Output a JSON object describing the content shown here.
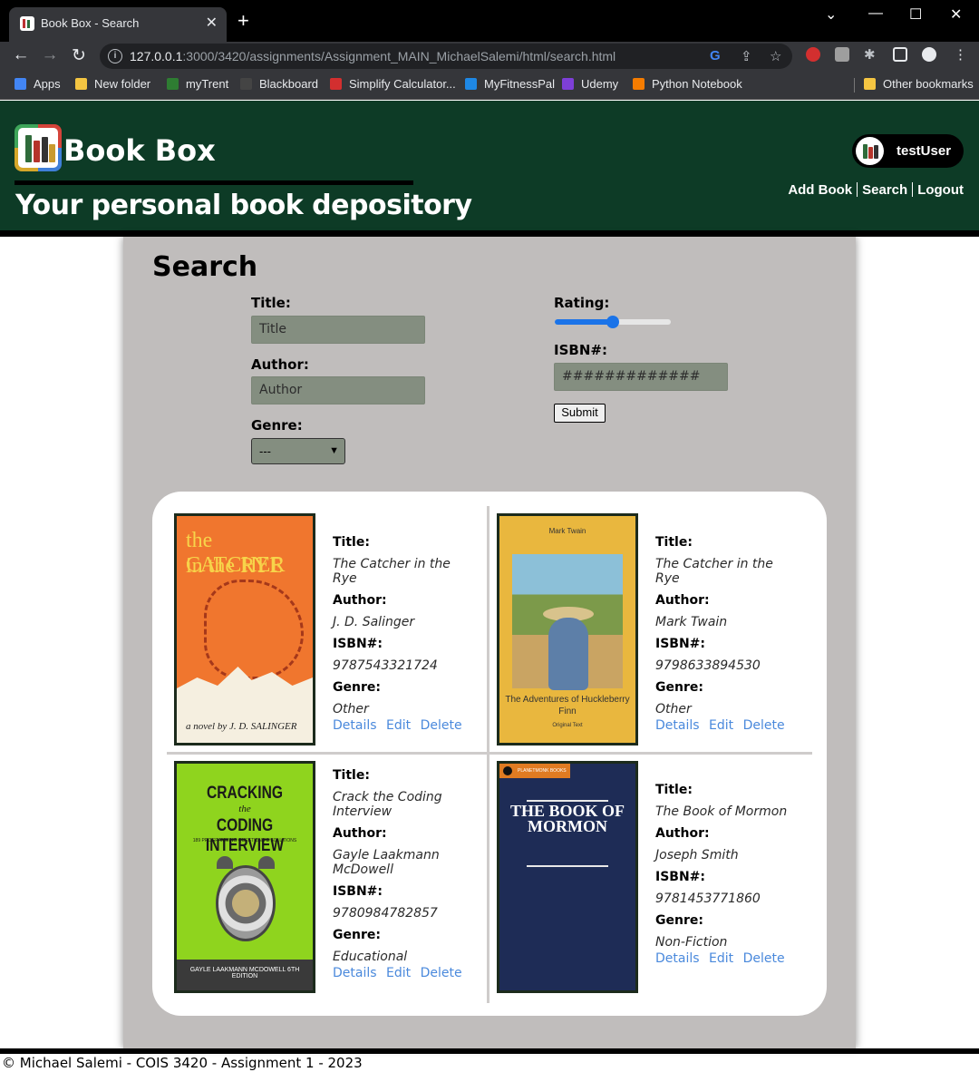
{
  "browser": {
    "tab_title": "Book Box - Search",
    "url_host": "127.0.0.1",
    "url_rest": ":3000/3420/assignments/Assignment_MAIN_MichaelSalemi/html/search.html",
    "bookmarks": [
      {
        "label": "Apps",
        "color": "#4285f4"
      },
      {
        "label": "New folder",
        "color": "#f4c542"
      },
      {
        "label": "myTrent",
        "color": "#2e7d32"
      },
      {
        "label": "Blackboard",
        "color": "#444444"
      },
      {
        "label": "Simplify Calculator...",
        "color": "#d32f2f"
      },
      {
        "label": "MyFitnessPal",
        "color": "#1e88e5"
      },
      {
        "label": "Udemy",
        "color": "#7e3fd8"
      },
      {
        "label": "Python Notebook",
        "color": "#f57c00"
      }
    ],
    "other_bookmarks": "Other bookmarks"
  },
  "site": {
    "title": "Book Box",
    "tagline": "Your personal book depository",
    "username": "testUser",
    "nav": [
      "Add Book",
      "Search",
      "Logout"
    ]
  },
  "search": {
    "heading": "Search",
    "title_label": "Title:",
    "title_placeholder": "Title",
    "author_label": "Author:",
    "author_placeholder": "Author",
    "genre_label": "Genre:",
    "genre_selected": "---",
    "rating_label": "Rating:",
    "rating_fraction": 0.5,
    "isbn_label": "ISBN#:",
    "isbn_placeholder": "#############",
    "submit_label": "Submit"
  },
  "labels": {
    "title": "Title:",
    "author": "Author:",
    "isbn": "ISBN#:",
    "genre": "Genre:",
    "details": "Details",
    "edit": "Edit",
    "delete": "Delete"
  },
  "books": [
    {
      "title": "The Catcher in the Rye",
      "author": "J. D. Salinger",
      "isbn": "9787543321724",
      "genre": "Other",
      "cover_title_1": "the CATCHER",
      "cover_title_2": "in the RYE",
      "cover_byline": "a novel by  J. D. SALINGER"
    },
    {
      "title": "The Catcher in the Rye",
      "author": "Mark Twain",
      "isbn": "9798633894530",
      "genre": "Other",
      "cover_author": "Mark Twain",
      "cover_title": "The Adventures of Huckleberry Finn",
      "cover_sub": "Original Text"
    },
    {
      "title": "Crack the Coding Interview",
      "author": "Gayle Laakmann McDowell",
      "isbn": "9780984782857",
      "genre": "Educational",
      "cover_t1": "CRACKING",
      "cover_t2": "the",
      "cover_t3": "CODING INTERVIEW",
      "cover_t4": "189 PROGRAMMING QUESTIONS & SOLUTIONS",
      "cover_band": "GAYLE LAAKMANN MCDOWELL  6TH EDITION"
    },
    {
      "title": "The Book of Mormon",
      "author": "Joseph Smith",
      "isbn": "9781453771860",
      "genre": "Non-Fiction",
      "cover_brand": "PLANETMONK BOOKS",
      "cover_title": "THE BOOK OF MORMON"
    }
  ],
  "footer": "© Michael Salemi - COIS 3420 - Assignment 1 - 2023"
}
